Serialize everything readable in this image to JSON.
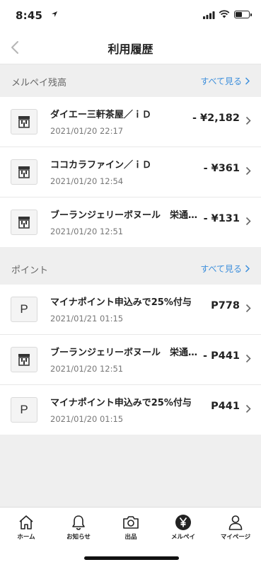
{
  "status": {
    "time": "8:45"
  },
  "nav": {
    "title": "利用履歴"
  },
  "balance_section": {
    "title": "メルペイ残高",
    "see_all": "すべて見る",
    "items": [
      {
        "name": "ダイエー三軒茶屋／ｉＤ",
        "date": "2021/01/20 22:17",
        "amount": "- ¥2,182",
        "icon": "store-icon"
      },
      {
        "name": "ココカラファイン／ｉＤ",
        "date": "2021/01/20 12:54",
        "amount": "- ¥361",
        "icon": "store-icon"
      },
      {
        "name": "ブーランジェリーボヌール　栄通…",
        "date": "2021/01/20 12:51",
        "amount": "- ¥131",
        "icon": "store-icon"
      }
    ]
  },
  "points_section": {
    "title": "ポイント",
    "see_all": "すべて見る",
    "items": [
      {
        "name": "マイナポイント申込みで25%付与",
        "date": "2021/01/21 01:15",
        "amount": "P778",
        "icon": "point-icon",
        "icon_letter": "P"
      },
      {
        "name": "ブーランジェリーボヌール　栄通…",
        "date": "2021/01/20 12:51",
        "amount": "- P441",
        "icon": "store-icon"
      },
      {
        "name": "マイナポイント申込みで25%付与",
        "date": "2021/01/20 01:15",
        "amount": "P441",
        "icon": "point-icon",
        "icon_letter": "P"
      }
    ]
  },
  "tabbar": {
    "home": "ホーム",
    "notifications": "お知らせ",
    "sell": "出品",
    "merpay": "メルペイ",
    "mypage": "マイページ"
  },
  "colors": {
    "link": "#3d8fdc",
    "background": "#efefef",
    "text": "#222222"
  }
}
